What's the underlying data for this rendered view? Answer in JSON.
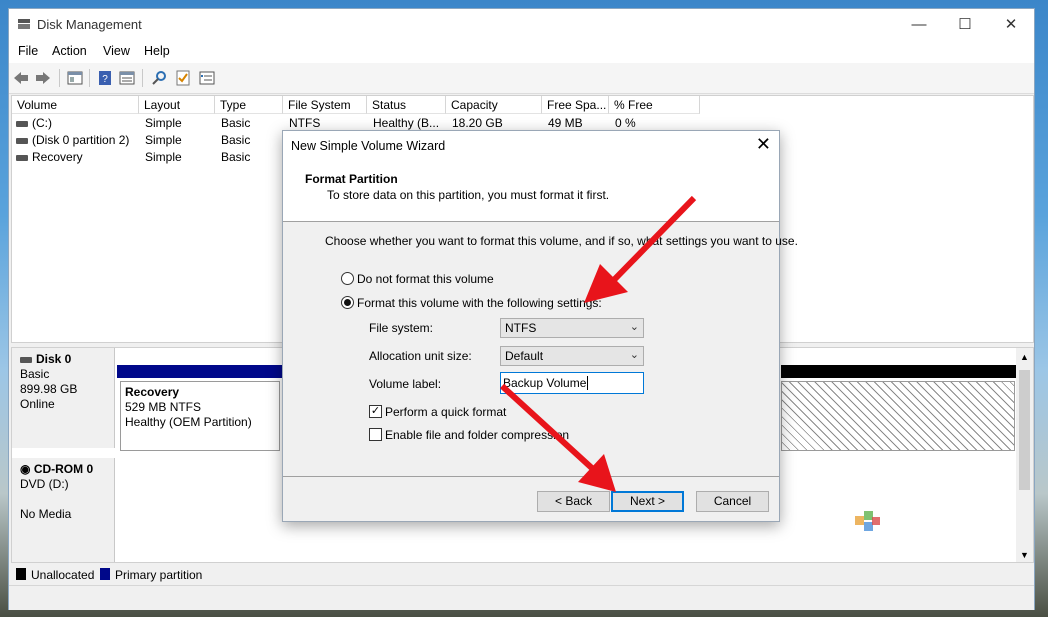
{
  "app": {
    "title": "Disk Management",
    "menu": [
      "File",
      "Action",
      "View",
      "Help"
    ],
    "window_controls": {
      "minimize": "—",
      "maximize": "☐",
      "close": "✕"
    }
  },
  "toolbar": {
    "icons": [
      "back-icon",
      "forward-icon",
      "console-tree-icon",
      "help-icon",
      "properties-icon",
      "connect-icon",
      "checklist-icon",
      "settings-icon"
    ]
  },
  "volume_table": {
    "columns": [
      "Volume",
      "Layout",
      "Type",
      "File System",
      "Status",
      "Capacity",
      "Free Spa...",
      "% Free"
    ],
    "rows": [
      [
        "(C:)",
        "Simple",
        "Basic",
        "NTFS",
        "Healthy (B...",
        "18.20 GB",
        "49 MB",
        "0 %"
      ],
      [
        "(Disk 0 partition 2)",
        "Simple",
        "Basic",
        "",
        "",
        "",
        "",
        ""
      ],
      [
        "Recovery",
        "Simple",
        "Basic",
        "",
        "",
        "",
        "",
        ""
      ]
    ]
  },
  "disks": [
    {
      "name": "Disk 0",
      "line1": "Basic",
      "line2": "899.98 GB",
      "line3": "Online"
    },
    {
      "name": "CD-ROM 0",
      "line1": "DVD (D:)",
      "line2": "",
      "line3": "No Media"
    }
  ],
  "recovery_partition": {
    "name": "Recovery",
    "size": "529 MB NTFS",
    "status": "Healthy (OEM Partition)"
  },
  "legend": {
    "unallocated": "Unallocated",
    "primary": "Primary partition",
    "unallocated_color": "#000000",
    "primary_color": "#00088a"
  },
  "dialog": {
    "title": "New Simple Volume Wizard",
    "close": "✕",
    "heading": "Format Partition",
    "subheading": "To store data on this partition, you must format it first.",
    "instruction": "Choose whether you want to format this volume, and if so, what settings you want to use.",
    "radio_no_format": "Do not format this volume",
    "radio_format": "Format this volume with the following settings:",
    "radio_format_selected": true,
    "file_system_label": "File system:",
    "file_system_value": "NTFS",
    "alloc_label": "Allocation unit size:",
    "alloc_value": "Default",
    "volume_label_label": "Volume label:",
    "volume_label_value": "Backup Volume",
    "quick_format": "Perform a quick format",
    "quick_format_checked": true,
    "compression": "Enable file and folder compression",
    "compression_checked": false,
    "back": "< Back",
    "next": "Next >",
    "cancel": "Cancel"
  },
  "watermark": "WinBuzzer",
  "annotation_color": "#e8141b"
}
